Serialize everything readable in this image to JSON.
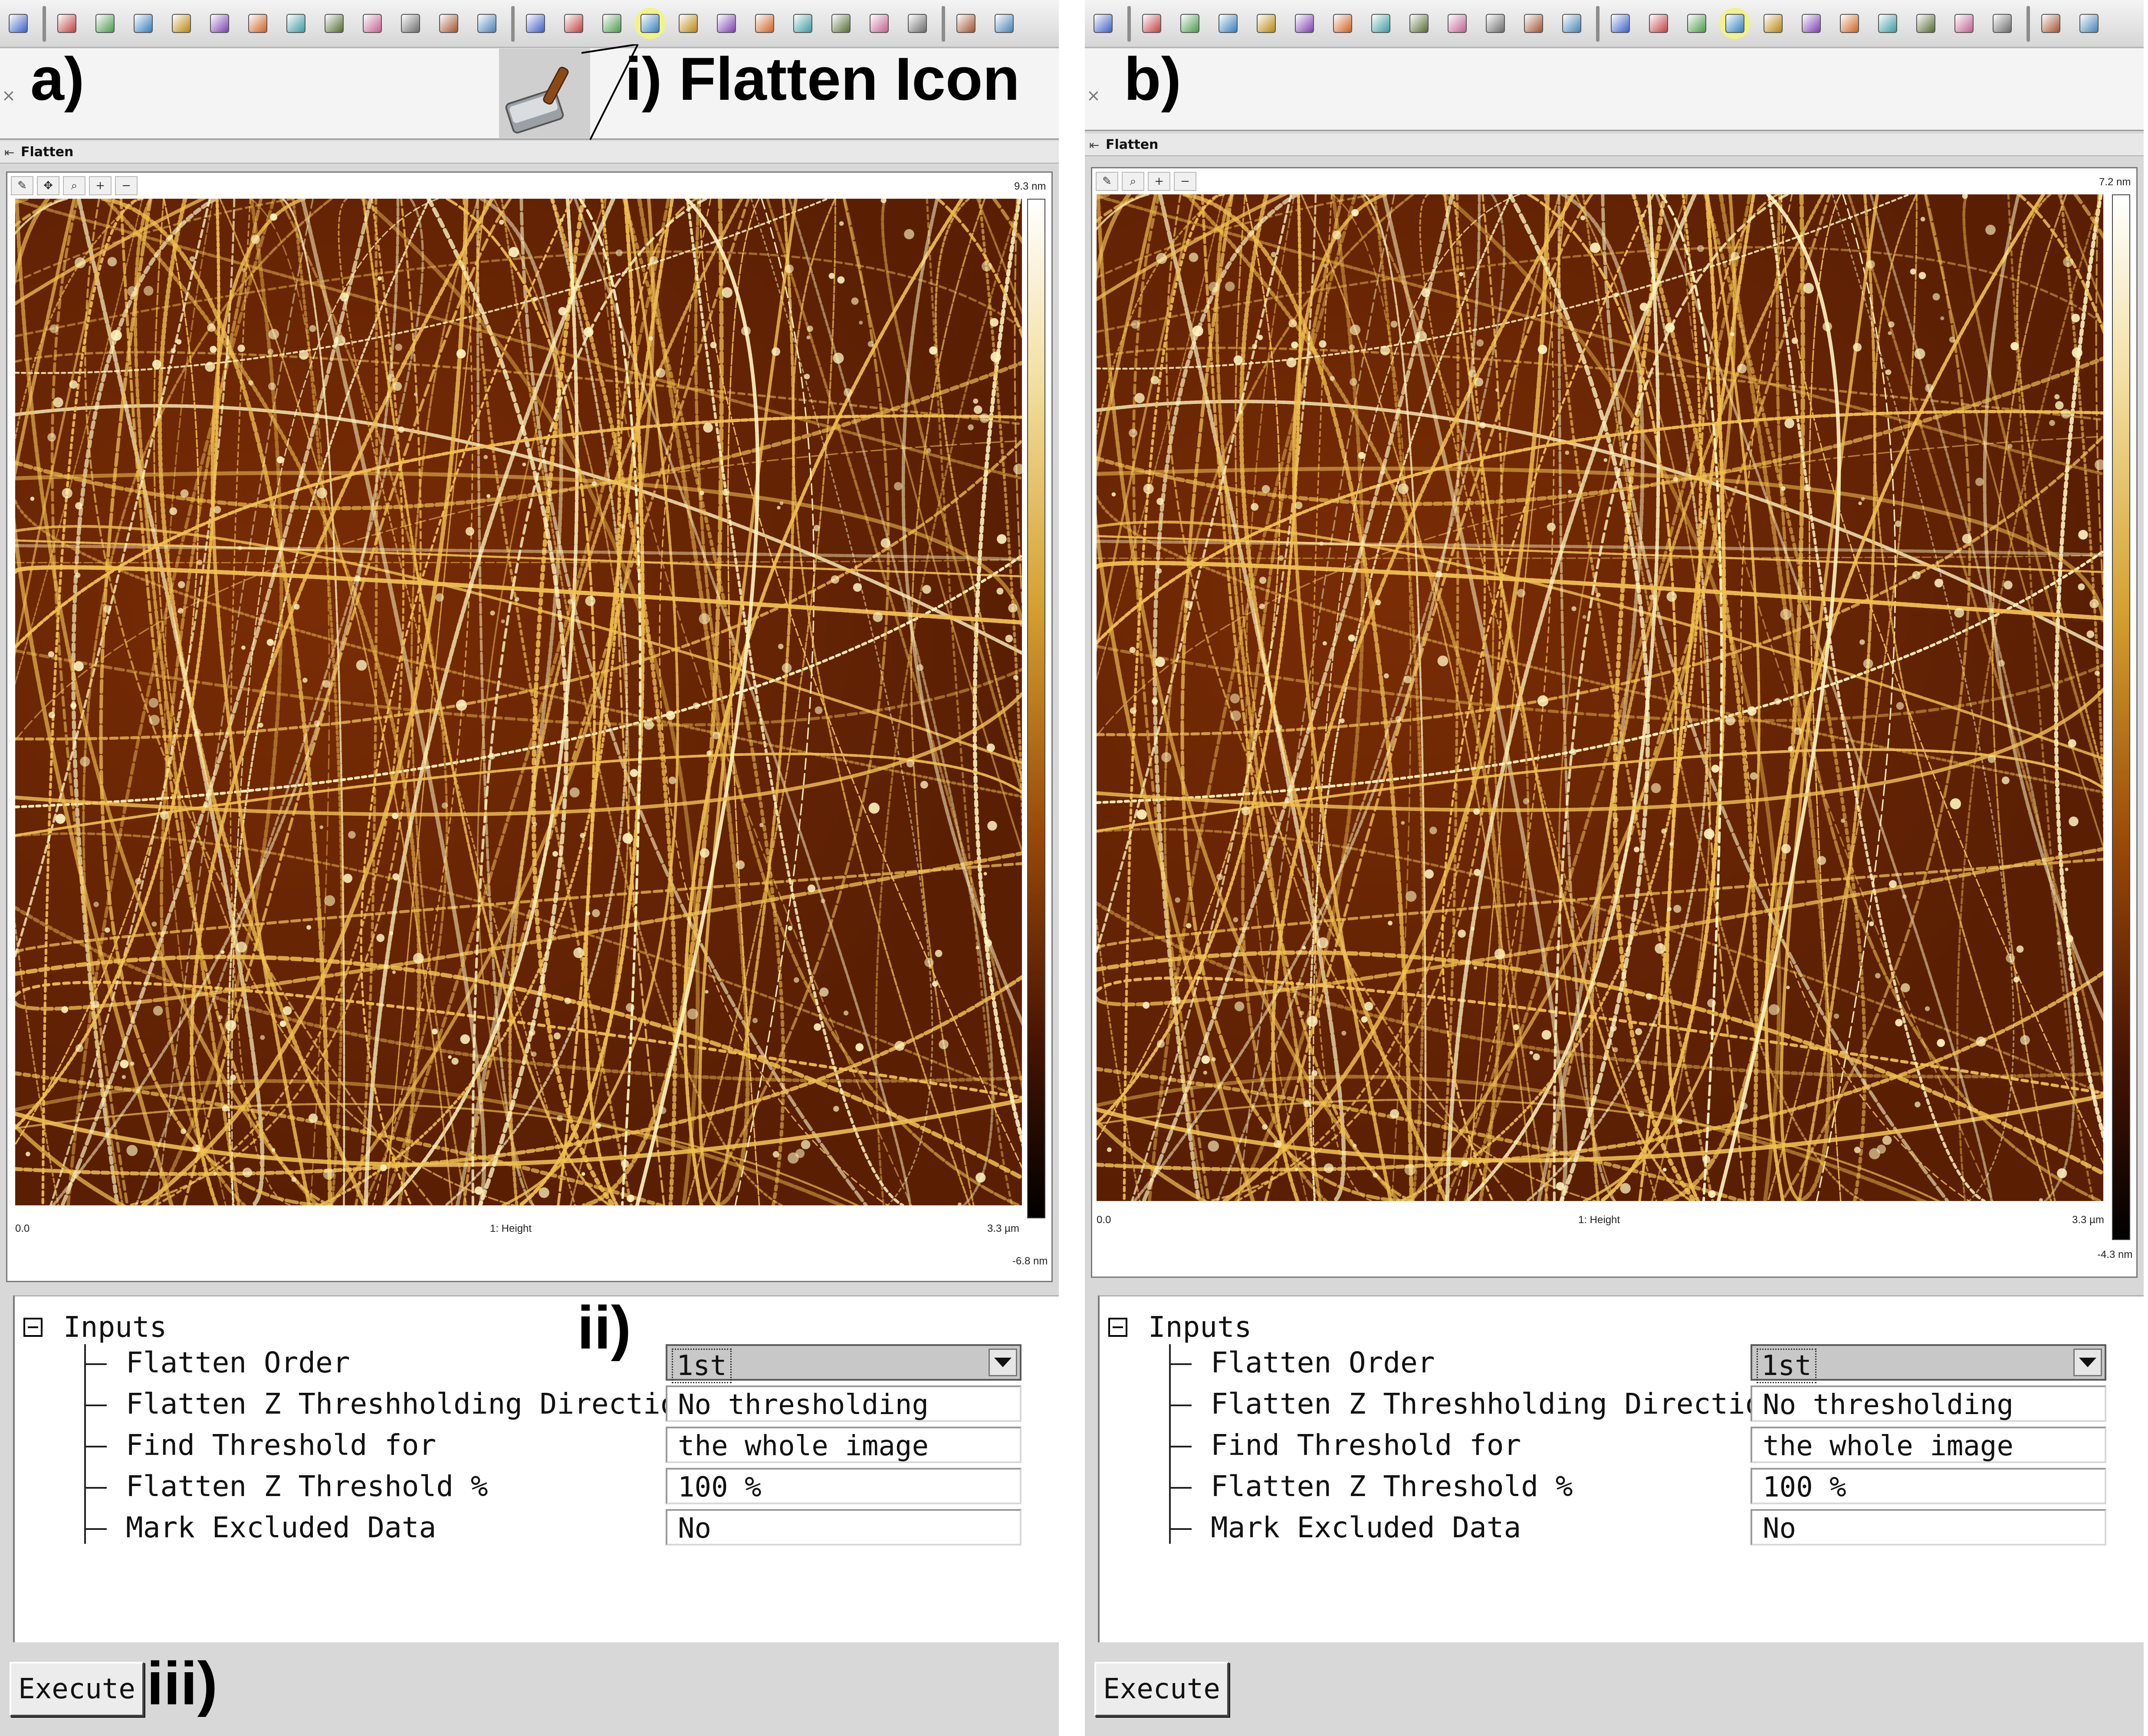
{
  "panel_a": {
    "letter": "a)",
    "callout_flatten": "i) Flatten Icon",
    "callout_inputs": "ii)",
    "callout_execute": "iii)",
    "window_title": "Flatten",
    "close_glyph": "×",
    "image": {
      "colorbar_max": "9.3 nm",
      "colorbar_min": "-6.8 nm",
      "axis_start": "0.0",
      "axis_end": "3.3 µm",
      "channel": "1: Height"
    }
  },
  "panel_b": {
    "letter": "b)",
    "window_title": "Flatten",
    "close_glyph": "×",
    "image": {
      "colorbar_max": "7.2 nm",
      "colorbar_min": "-4.3 nm",
      "axis_start": "0.0",
      "axis_end": "3.3 µm",
      "channel": "1: Height"
    }
  },
  "inputs": {
    "title": "Inputs",
    "params": [
      {
        "label": "Flatten Order",
        "value": "1st",
        "type": "select"
      },
      {
        "label": "Flatten Z Threshholding Direction",
        "value": "No thresholding",
        "type": "field"
      },
      {
        "label": "Find Threshold for",
        "value": "the whole image",
        "type": "field"
      },
      {
        "label": "Flatten Z Threshold %",
        "value": "100 %",
        "type": "field"
      },
      {
        "label": "Mark Excluded Data",
        "value": "No",
        "type": "field"
      }
    ],
    "execute_label": "Execute"
  },
  "toolbar_icons": [
    "help-icon",
    "grid-icon",
    "plane-fit-icon",
    "flatten-3d-icon",
    "block-icon",
    "filter-icon",
    "fire-icon",
    "spectrum-icon",
    "section-icon",
    "depth-icon",
    "bearing-icon",
    "step-icon",
    "rotate-icon",
    "line-tool-icon",
    "crop-icon",
    "brush-icon",
    "flatten-icon",
    "filter-funnel-icon",
    "grid-analysis-icon",
    "filter-funnel-2-icon",
    "filter-funnel-3-icon",
    "render-3d-icon",
    "undo-icon",
    "view-icon",
    "layout-icon",
    "page-icon"
  ],
  "colors": {
    "highlight": "#f2f28a",
    "afm_dark": "#5a1f03",
    "afm_fiber": "#f0c050",
    "afm_bright": "#fff4c0"
  }
}
